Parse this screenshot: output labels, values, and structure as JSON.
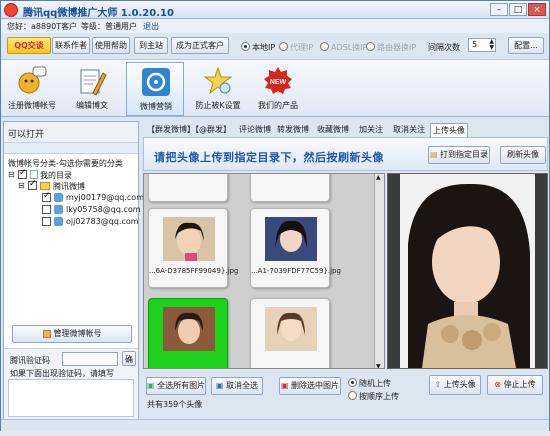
{
  "app": {
    "title": "腾讯qq微博推广大师 1.0.20.10"
  },
  "userbar": {
    "user": "您好：a8890T客户",
    "level": "等级：普通用户",
    "logout": "退出"
  },
  "toolbar": {
    "qq_label": "QQ交谈",
    "contact": "联系作者",
    "help": "使用帮助",
    "home": "到主站",
    "upgrade": "成为正式客户",
    "ip_local": "本地IP",
    "ip_proxy": "代理IP",
    "ip_adsl": "ADSL换IP",
    "ip_router": "路由器换IP",
    "interval_label": "间隔次数",
    "interval_value": "5",
    "config": "配置..."
  },
  "nav": [
    {
      "label": "注册微博帐号"
    },
    {
      "label": "编辑博文"
    },
    {
      "label": "微博营销"
    },
    {
      "label": "防止被K设置"
    },
    {
      "label": "我们的产品"
    }
  ],
  "left": {
    "header": "可以打开",
    "hint": "微博帐号分类-勾选你需要的分类",
    "root": "我的目录",
    "group": "腾讯微博",
    "accounts": [
      "myj00179@qq.com",
      "lky05758@qq.com",
      "ojj02783@qq.com"
    ],
    "manage": "管理微博帐号",
    "captcha_label": "腾讯验证码",
    "captcha_hint": "如果下面出现验证码，请填写",
    "captcha_btn": "确"
  },
  "tabs": [
    "【群发微博】",
    "【@群发】",
    "评论微博",
    "转发微博",
    "收藏微博",
    "加关注",
    "取消关注",
    "上传头像"
  ],
  "banner": {
    "message": "请把头像上传到指定目录下，然后按刷新头像",
    "open_dir": "打到指定目录",
    "refresh": "刷新头像"
  },
  "gallery": {
    "captions": [
      "...6A-D3785FF99049}.jpg",
      "...A1-7039FDF77C59}.jpg"
    ]
  },
  "bottom": {
    "select_all": "全选所有图片",
    "deselect": "取消全选",
    "delete": "删除选中图片",
    "random": "随机上传",
    "sequential": "按顺序上传",
    "upload": "上传头像",
    "stop": "停止上传",
    "count": "共有359个头像"
  }
}
